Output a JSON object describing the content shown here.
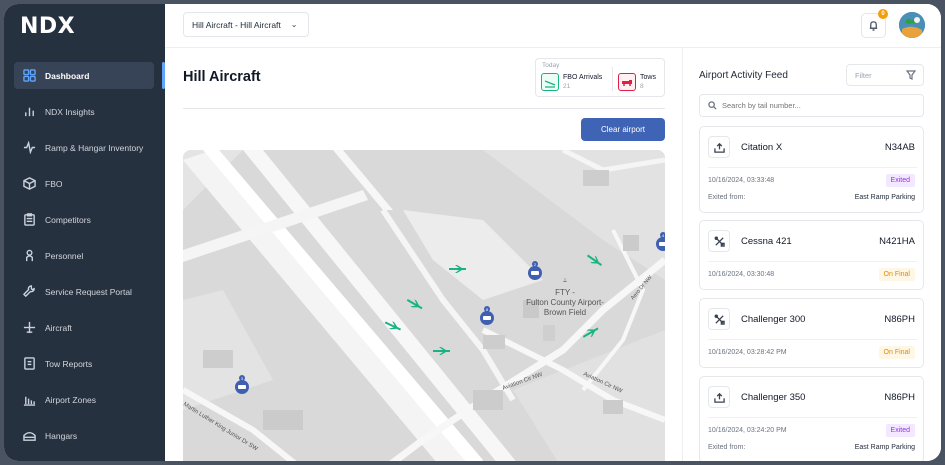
{
  "app": {
    "logo": "NDX"
  },
  "sidebar": {
    "items": [
      {
        "label": "Dashboard",
        "icon": "grid-icon",
        "active": true
      },
      {
        "label": "NDX Insights",
        "icon": "bar-chart-icon"
      },
      {
        "label": "Ramp & Hangar Inventory",
        "icon": "activity-icon"
      },
      {
        "label": "FBO",
        "icon": "box-icon"
      },
      {
        "label": "Competitors",
        "icon": "clipboard-icon"
      },
      {
        "label": "Personnel",
        "icon": "person-icon"
      },
      {
        "label": "Service Request Portal",
        "icon": "wrench-icon"
      },
      {
        "label": "Aircraft",
        "icon": "plane-icon"
      },
      {
        "label": "Tow Reports",
        "icon": "report-icon"
      },
      {
        "label": "Airport Zones",
        "icon": "zones-icon"
      },
      {
        "label": "Hangars",
        "icon": "hangar-icon"
      }
    ]
  },
  "header": {
    "org_select": "Hill Aircraft - Hill Aircraft",
    "notification_count": "0"
  },
  "main": {
    "title": "Hill Aircraft",
    "today": {
      "label": "Today",
      "fbo_arrivals_label": "FBO Arrivals",
      "fbo_arrivals_value": "21",
      "tows_label": "Tows",
      "tows_value": "8"
    },
    "clear_button": "Clear airport",
    "map": {
      "airport_label_1": "FTY -",
      "airport_label_2": "Fulton County Airport-",
      "airport_label_3": "Brown Field",
      "road_1": "Aviation Cir NW",
      "road_2": "Aviation Cir NW",
      "road_3": "Martin Luther King Junior Dr SW",
      "road_4": "Aero Dr NW",
      "pin_1": "2",
      "pin_2": "8",
      "pin_3": "3",
      "pin_4": "4"
    }
  },
  "feed": {
    "title": "Airport Activity Feed",
    "filter_placeholder": "Filter",
    "search_placeholder": "Search by tail number...",
    "cards": [
      {
        "icon": "upload-icon",
        "name": "Citation X",
        "tail": "N34AB",
        "time": "10/16/2024, 03:33:48",
        "status": "Exited",
        "status_kind": "exited",
        "label": "Exited from:",
        "location": "East Ramp Parking"
      },
      {
        "icon": "tools-icon",
        "name": "Cessna 421",
        "tail": "N421HA",
        "time": "10/16/2024, 03:30:48",
        "status": "On Final",
        "status_kind": "final"
      },
      {
        "icon": "tools-icon",
        "name": "Challenger 300",
        "tail": "N86PH",
        "time": "10/16/2024, 03:28:42 PM",
        "status": "On Final",
        "status_kind": "final"
      },
      {
        "icon": "upload-icon",
        "name": "Challenger 350",
        "tail": "N86PH",
        "time": "10/16/2024, 03:24:20 PM",
        "status": "Exited",
        "status_kind": "exited",
        "label": "Exited from:",
        "location": "East Ramp Parking"
      }
    ]
  },
  "colors": {
    "sidebar_bg": "#263140",
    "accent": "#3f64b5",
    "aircraft_green": "#19b383",
    "pin_blue": "#3f5fb0"
  }
}
